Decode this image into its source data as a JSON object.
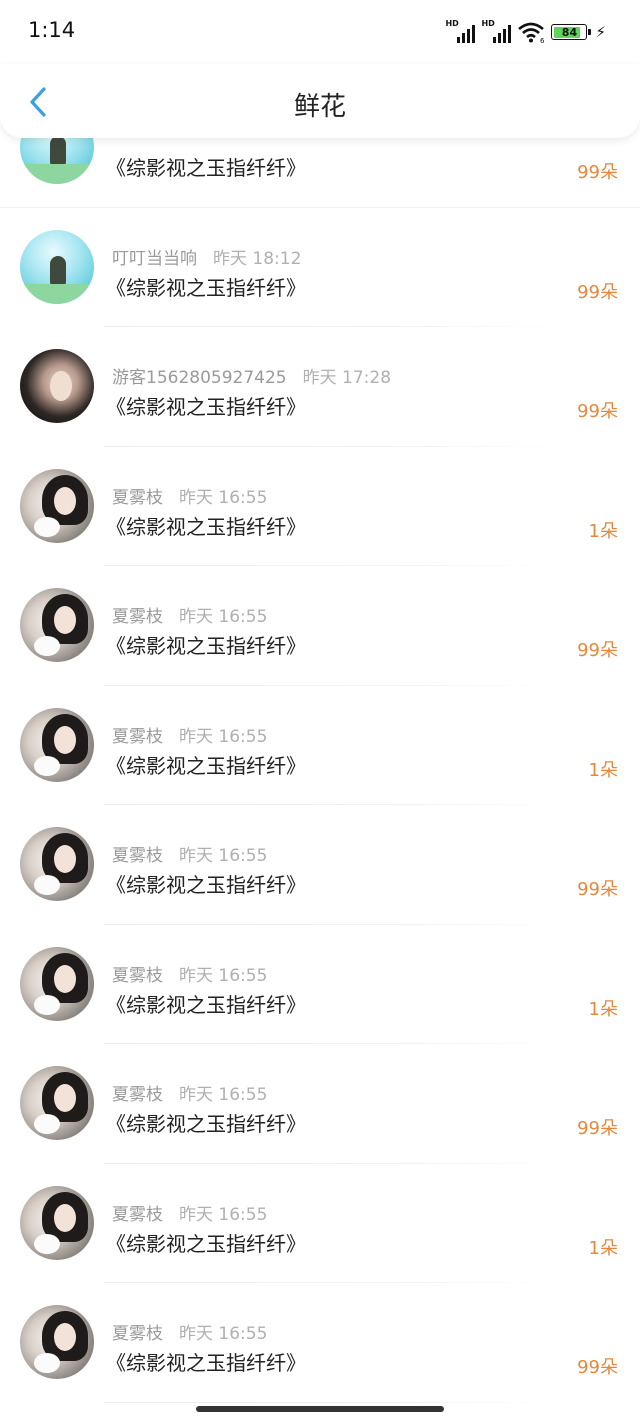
{
  "status_bar": {
    "time": "1:14",
    "signal_1_label": "HD",
    "signal_2_label": "HD",
    "wifi_sub": "6",
    "battery_level": "84",
    "charging": true
  },
  "nav": {
    "title": "鲜花",
    "back_icon": "chevron-left-icon"
  },
  "colors": {
    "accent": "#3aa0e6",
    "amount": "#e5883c",
    "meta_text": "#9a9a9a"
  },
  "items": [
    {
      "user": "",
      "time": "",
      "title": "《综影视之玉指纤纤》",
      "amount": "99朵",
      "avatar": "sky"
    },
    {
      "user": "叮叮当当响",
      "time": "昨天 18:12",
      "title": "《综影视之玉指纤纤》",
      "amount": "99朵",
      "avatar": "sky"
    },
    {
      "user": "游客1562805927425",
      "time": "昨天 17:28",
      "title": "《综影视之玉指纤纤》",
      "amount": "99朵",
      "avatar": "dark"
    },
    {
      "user": "夏雾枝",
      "time": "昨天 16:55",
      "title": "《综影视之玉指纤纤》",
      "amount": "1朵",
      "avatar": "girl"
    },
    {
      "user": "夏雾枝",
      "time": "昨天 16:55",
      "title": "《综影视之玉指纤纤》",
      "amount": "99朵",
      "avatar": "girl"
    },
    {
      "user": "夏雾枝",
      "time": "昨天 16:55",
      "title": "《综影视之玉指纤纤》",
      "amount": "1朵",
      "avatar": "girl"
    },
    {
      "user": "夏雾枝",
      "time": "昨天 16:55",
      "title": "《综影视之玉指纤纤》",
      "amount": "99朵",
      "avatar": "girl"
    },
    {
      "user": "夏雾枝",
      "time": "昨天 16:55",
      "title": "《综影视之玉指纤纤》",
      "amount": "1朵",
      "avatar": "girl"
    },
    {
      "user": "夏雾枝",
      "time": "昨天 16:55",
      "title": "《综影视之玉指纤纤》",
      "amount": "99朵",
      "avatar": "girl"
    },
    {
      "user": "夏雾枝",
      "time": "昨天 16:55",
      "title": "《综影视之玉指纤纤》",
      "amount": "1朵",
      "avatar": "girl"
    },
    {
      "user": "夏雾枝",
      "time": "昨天 16:55",
      "title": "《综影视之玉指纤纤》",
      "amount": "99朵",
      "avatar": "girl"
    }
  ]
}
